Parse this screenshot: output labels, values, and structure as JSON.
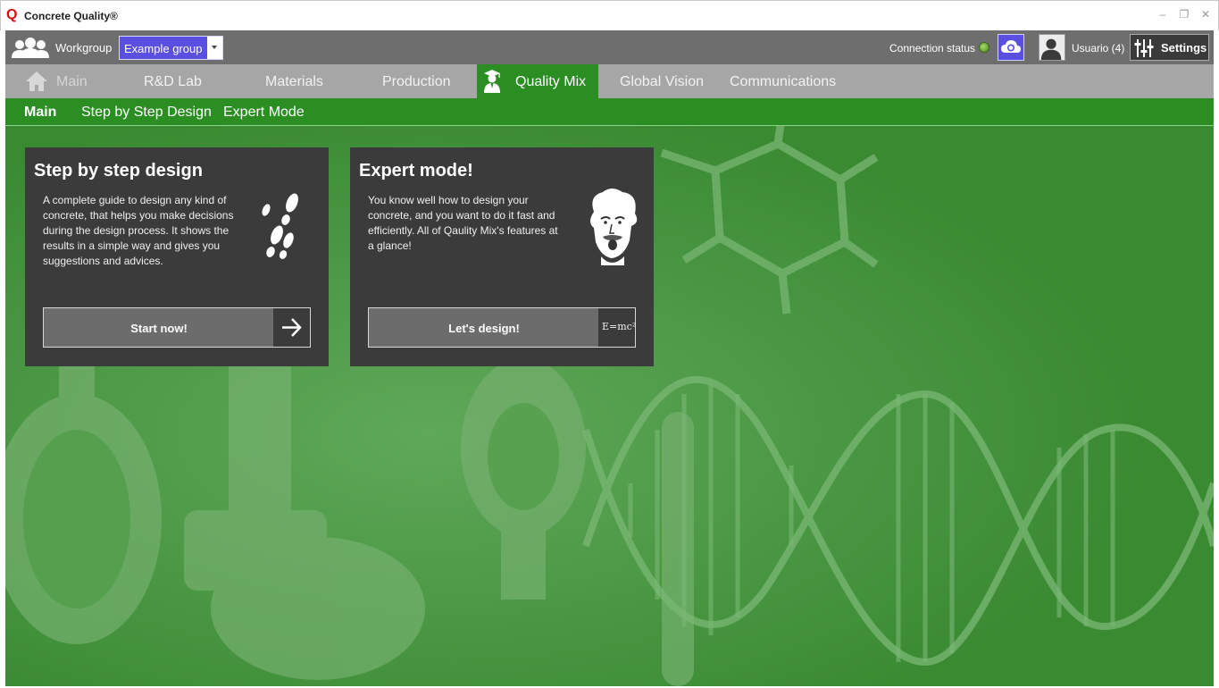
{
  "window": {
    "logo_char": "Q",
    "title": "Concrete Quality®",
    "controls": {
      "minimize": "–",
      "restore": "❐",
      "close": "✕"
    }
  },
  "topbar": {
    "workgroup_label": "Workgroup",
    "workgroup_selected": "Example group",
    "connection_label": "Connection status",
    "user_label": "Usuario (4)",
    "settings_label": "Settings"
  },
  "main_tabs": [
    {
      "label": "Main"
    },
    {
      "label": "R&D Lab"
    },
    {
      "label": "Materials"
    },
    {
      "label": "Production"
    },
    {
      "label": "Quality Mix"
    },
    {
      "label": "Global Vision"
    },
    {
      "label": "Communications"
    }
  ],
  "sub_tabs": [
    {
      "label": "Main"
    },
    {
      "label": "Step by Step Design"
    },
    {
      "label": "Expert Mode"
    }
  ],
  "cards": [
    {
      "title": "Step by step design",
      "description": "A complete guide to design any kind of concrete, that helps you make decisions during the design process. It shows the results in a simple way and gives you suggestions and advices.",
      "button_label": "Start now!"
    },
    {
      "title": "Expert mode!",
      "description": "You know well how to design your concrete, and you want to do it fast and efficiently. All of Qaulity Mix's features at a glance!",
      "button_label": "Let's design!",
      "button_icon_text": "E=mc²"
    }
  ],
  "colors": {
    "accent_green": "#2a8e23",
    "select_blue": "#5a4fe0",
    "card_bg": "#3b3b3b",
    "brand_red": "#d01010"
  },
  "icons": {
    "workgroup": "users-icon",
    "connection": "status-led-icon",
    "cloud": "cloud-sync-icon",
    "user": "avatar-icon",
    "settings": "sliders-icon",
    "home": "home-icon",
    "quality_mix": "graduate-icon",
    "step": "footprints-icon",
    "expert": "scientist-icon",
    "arrow": "arrow-right-icon"
  }
}
